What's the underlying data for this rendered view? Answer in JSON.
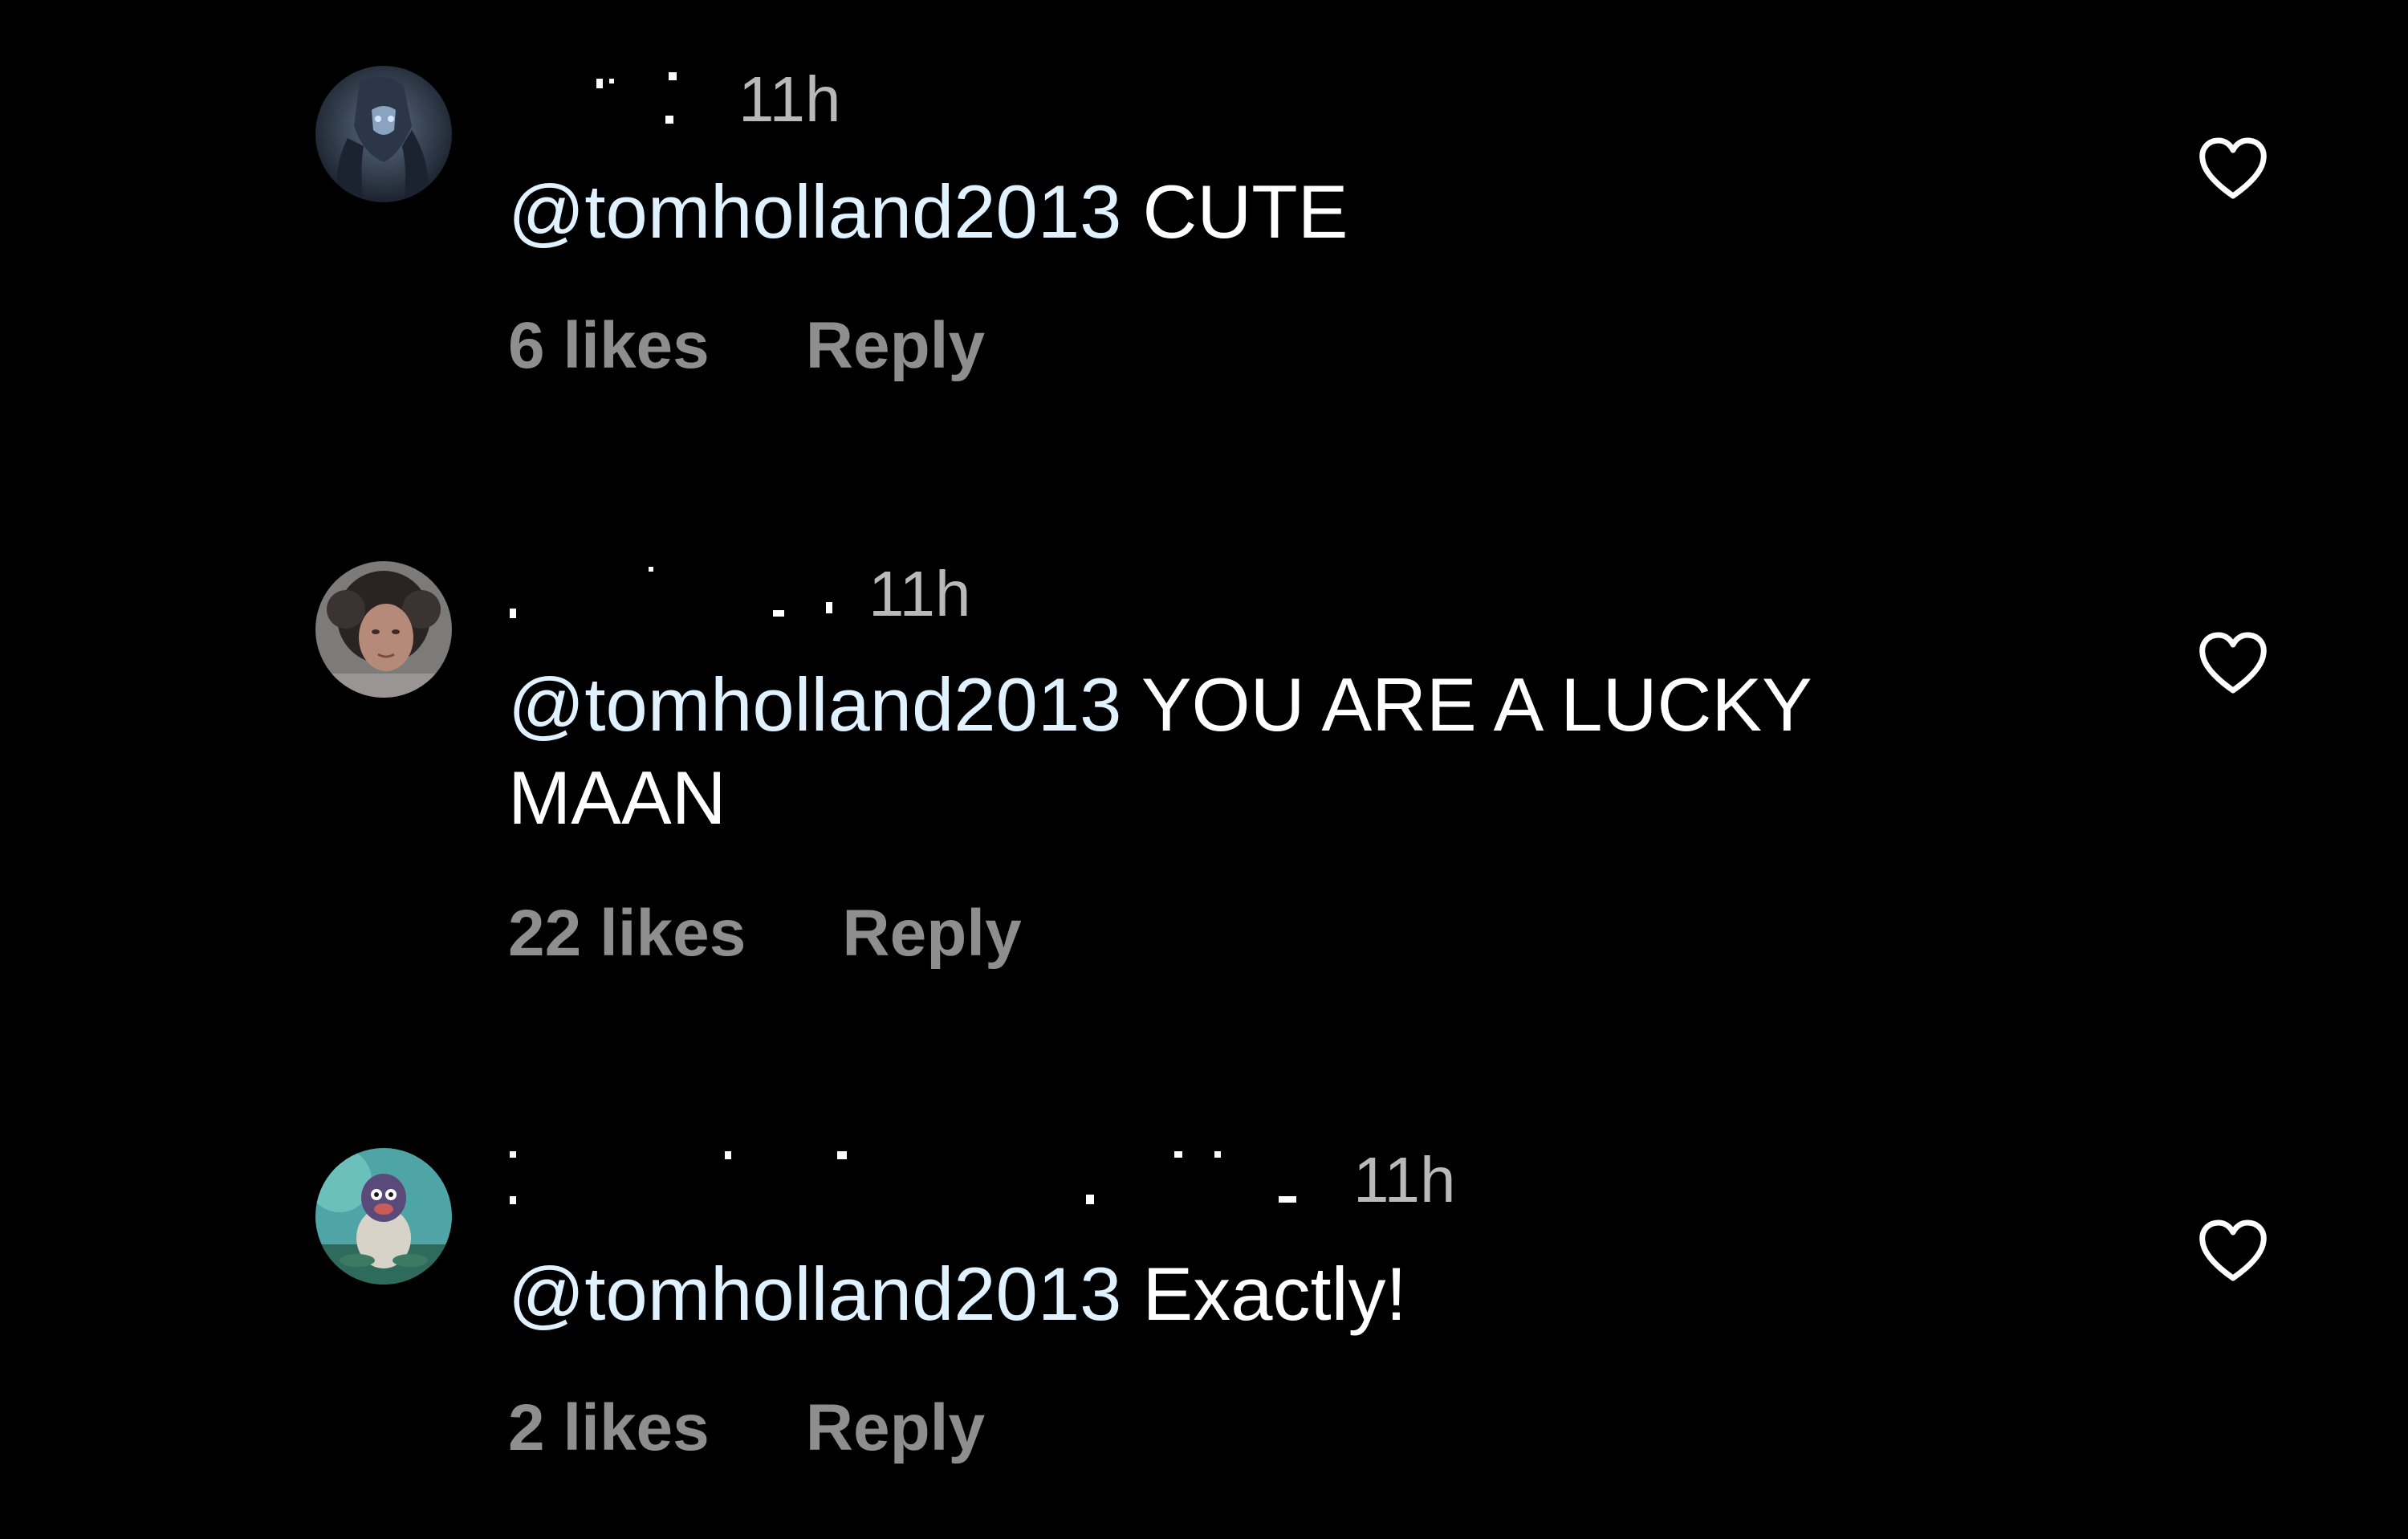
{
  "comments": [
    {
      "time": "11h",
      "mention": "@tomholland2013",
      "text": " CUTE",
      "likes": "6 likes",
      "reply_label": "Reply"
    },
    {
      "time": "11h",
      "mention": "@tomholland2013",
      "text": " YOU ARE A LUCKY MAAN",
      "likes": "22 likes",
      "reply_label": "Reply"
    },
    {
      "time": "11h",
      "mention": "@tomholland2013",
      "text": " Exactly!",
      "likes": "2 likes",
      "reply_label": "Reply"
    }
  ],
  "colors": {
    "background": "#000000",
    "comment_text": "#ffffff",
    "mention": "#e0f1ff",
    "meta": "#8e8e8e",
    "time": "#b9b9b9",
    "heart_stroke": "#ffffff"
  },
  "icons": {
    "like": "heart-outline-icon"
  }
}
